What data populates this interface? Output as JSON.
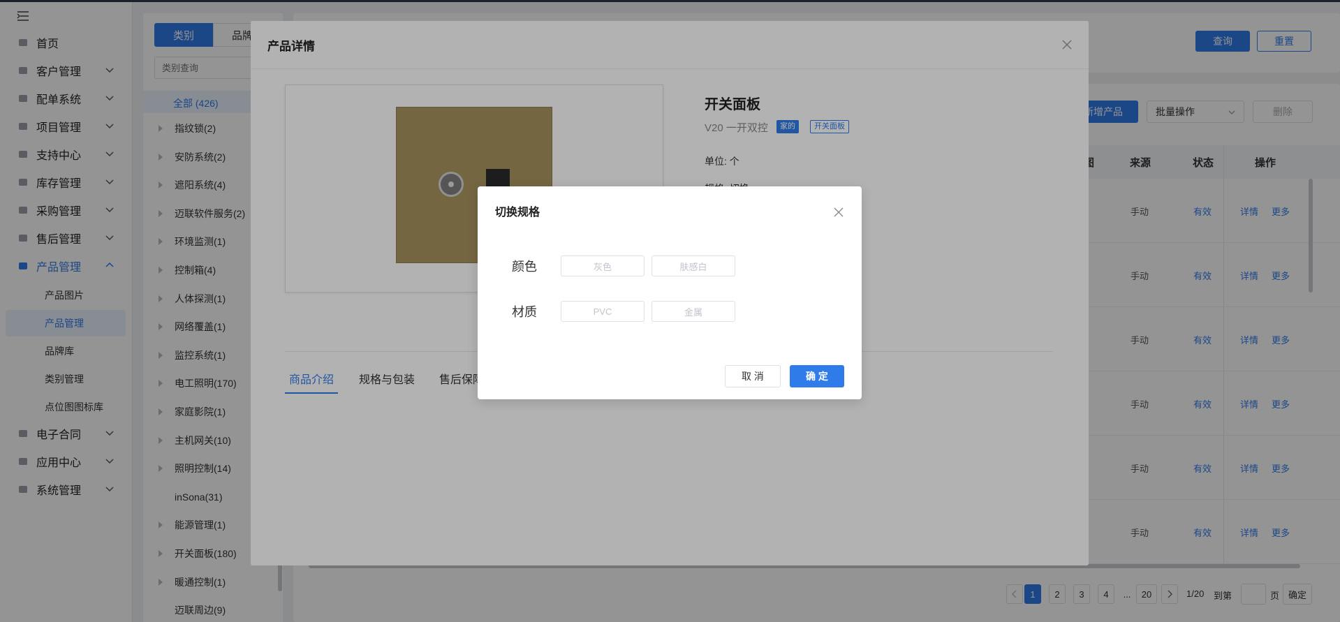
{
  "sidebar": {
    "items": [
      {
        "label": "首页",
        "icon": "home-icon",
        "expandable": false
      },
      {
        "label": "客户管理",
        "icon": "customer-icon",
        "expandable": true
      },
      {
        "label": "配单系统",
        "icon": "order-icon",
        "expandable": true
      },
      {
        "label": "项目管理",
        "icon": "folder-icon",
        "expandable": true
      },
      {
        "label": "支持中心",
        "icon": "wrench-icon",
        "expandable": true
      },
      {
        "label": "库存管理",
        "icon": "stock-icon",
        "expandable": true
      },
      {
        "label": "采购管理",
        "icon": "cart-icon",
        "expandable": true
      },
      {
        "label": "售后管理",
        "icon": "headset-icon",
        "expandable": true
      },
      {
        "label": "产品管理",
        "icon": "product-icon",
        "expandable": true,
        "expanded": true
      },
      {
        "label": "电子合同",
        "icon": "contract-icon",
        "expandable": true
      },
      {
        "label": "应用中心",
        "icon": "apps-icon",
        "expandable": true
      },
      {
        "label": "系统管理",
        "icon": "settings-icon",
        "expandable": true
      }
    ],
    "sub_items": [
      "产品图片",
      "产品管理",
      "品牌库",
      "类别管理",
      "点位图图标库"
    ],
    "selected_sub": "产品管理"
  },
  "category_panel": {
    "tabs": [
      "类别",
      "品牌"
    ],
    "search_placeholder": "类别查询",
    "all_label": "全部 (426)",
    "items": [
      {
        "label": "指纹锁(2)",
        "has_children": true
      },
      {
        "label": "安防系统(2)",
        "has_children": true
      },
      {
        "label": "遮阳系统(4)",
        "has_children": true
      },
      {
        "label": "迈联软件服务(2)",
        "has_children": true
      },
      {
        "label": "环境监测(1)",
        "has_children": true
      },
      {
        "label": "控制箱(4)",
        "has_children": true
      },
      {
        "label": "人体探测(1)",
        "has_children": true
      },
      {
        "label": "网络覆盖(1)",
        "has_children": true
      },
      {
        "label": "监控系统(1)",
        "has_children": true
      },
      {
        "label": "电工照明(170)",
        "has_children": true
      },
      {
        "label": "家庭影院(1)",
        "has_children": true
      },
      {
        "label": "主机网关(10)",
        "has_children": true
      },
      {
        "label": "照明控制(14)",
        "has_children": true
      },
      {
        "label": "inSona(31)",
        "has_children": false
      },
      {
        "label": "能源管理(1)",
        "has_children": true
      },
      {
        "label": "开关面板(180)",
        "has_children": true
      },
      {
        "label": "暖通控制(1)",
        "has_children": true
      },
      {
        "label": "迈联周边(9)",
        "has_children": false
      }
    ]
  },
  "main": {
    "query_label": "查询",
    "reset_label": "重置",
    "add_product_label": "新增产品",
    "batch_label": "批量操作",
    "delete_label": "删除",
    "columns": [
      "图",
      "来源",
      "状态",
      "操作"
    ],
    "rows": [
      {
        "source": "手动",
        "status": "有效",
        "detail": "详情",
        "more": "更多"
      },
      {
        "source": "手动",
        "status": "有效",
        "detail": "详情",
        "more": "更多"
      },
      {
        "source": "手动",
        "status": "有效",
        "detail": "详情",
        "more": "更多"
      },
      {
        "source": "手动",
        "status": "有效",
        "detail": "详情",
        "more": "更多"
      },
      {
        "source": "手动",
        "status": "有效",
        "detail": "详情",
        "more": "更多"
      },
      {
        "source": "手动",
        "status": "有效",
        "detail": "详情",
        "more": "更多"
      }
    ],
    "pagination": {
      "pages": [
        "1",
        "2",
        "3",
        "4",
        "...",
        "20"
      ],
      "current": "1",
      "summary": "1/20",
      "goto_label": "到第",
      "page_suffix": "页",
      "confirm_label": "确定"
    }
  },
  "detail_modal": {
    "title": "产品详情",
    "product_name": "开关面板",
    "model": "V20 一开双控",
    "tags": [
      "家的",
      "开关面板"
    ],
    "unit_label": "单位: 个",
    "spec_partial": "规格: 切换",
    "tabs": [
      "商品介绍",
      "规格与包装",
      "售后保障"
    ],
    "active_tab": "商品介绍"
  },
  "spec_dialog": {
    "title": "切换规格",
    "groups": [
      {
        "label": "颜色",
        "options": [
          "灰色",
          "肤感白"
        ]
      },
      {
        "label": "材质",
        "options": [
          "PVC",
          "金属"
        ]
      }
    ],
    "cancel_label": "取 消",
    "ok_label": "确 定"
  },
  "colors": {
    "accent": "#2f7be9",
    "panel_gold": "#a8935f",
    "tag_blue": "#2f7be9"
  }
}
